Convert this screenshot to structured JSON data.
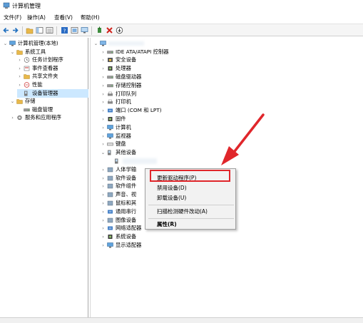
{
  "window": {
    "title": "计算机管理"
  },
  "menu": [
    "文件(F)",
    "操作(A)",
    "查看(V)",
    "帮助(H)"
  ],
  "left_tree": [
    {
      "label": "计算机管理(本地)",
      "indent": 0,
      "exp": "⌄",
      "icon": "computer-management-icon",
      "selected": false
    },
    {
      "label": "系统工具",
      "indent": 1,
      "exp": "⌄",
      "icon": "system-tools-icon",
      "selected": false
    },
    {
      "label": "任务计划程序",
      "indent": 2,
      "exp": "›",
      "icon": "task-scheduler-icon",
      "selected": false
    },
    {
      "label": "事件查看器",
      "indent": 2,
      "exp": "›",
      "icon": "event-viewer-icon",
      "selected": false
    },
    {
      "label": "共享文件夹",
      "indent": 2,
      "exp": "›",
      "icon": "shared-folders-icon",
      "selected": false
    },
    {
      "label": "性能",
      "indent": 2,
      "exp": "›",
      "icon": "performance-icon",
      "selected": false
    },
    {
      "label": "设备管理器",
      "indent": 2,
      "exp": "",
      "icon": "device-manager-icon",
      "selected": true
    },
    {
      "label": "存储",
      "indent": 1,
      "exp": "⌄",
      "icon": "storage-icon",
      "selected": false
    },
    {
      "label": "磁盘管理",
      "indent": 2,
      "exp": "",
      "icon": "disk-management-icon",
      "selected": false
    },
    {
      "label": "服务和应用程序",
      "indent": 1,
      "exp": "›",
      "icon": "services-apps-icon",
      "selected": false
    }
  ],
  "device_tree": [
    {
      "label": "IDE ATA/ATAPI 控制器",
      "indent": 1,
      "exp": "›",
      "icon": "ide-controller-icon"
    },
    {
      "label": "安全设备",
      "indent": 1,
      "exp": "›",
      "icon": "security-device-icon"
    },
    {
      "label": "处理器",
      "indent": 1,
      "exp": "›",
      "icon": "processor-icon"
    },
    {
      "label": "磁盘驱动器",
      "indent": 1,
      "exp": "›",
      "icon": "disk-drive-icon"
    },
    {
      "label": "存储控制器",
      "indent": 1,
      "exp": "›",
      "icon": "storage-controller-icon"
    },
    {
      "label": "打印队列",
      "indent": 1,
      "exp": "›",
      "icon": "print-queue-icon"
    },
    {
      "label": "打印机",
      "indent": 1,
      "exp": "›",
      "icon": "printer-icon"
    },
    {
      "label": "端口 (COM 和 LPT)",
      "indent": 1,
      "exp": "›",
      "icon": "port-icon"
    },
    {
      "label": "固件",
      "indent": 1,
      "exp": "›",
      "icon": "firmware-icon"
    },
    {
      "label": "计算机",
      "indent": 1,
      "exp": "›",
      "icon": "computer-icon"
    },
    {
      "label": "监视器",
      "indent": 1,
      "exp": "›",
      "icon": "monitor-icon"
    },
    {
      "label": "键盘",
      "indent": 1,
      "exp": "›",
      "icon": "keyboard-icon"
    },
    {
      "label": "其他设备",
      "indent": 1,
      "exp": "⌄",
      "icon": "other-devices-icon"
    },
    {
      "label": "",
      "indent": 2,
      "exp": "",
      "icon": "unknown-device-icon"
    },
    {
      "label": "人体学输",
      "indent": 1,
      "exp": "›",
      "icon": "hid-icon"
    },
    {
      "label": "软件设备",
      "indent": 1,
      "exp": "›",
      "icon": "software-device-icon"
    },
    {
      "label": "软件组件",
      "indent": 1,
      "exp": "›",
      "icon": "software-component-icon"
    },
    {
      "label": "声音、视",
      "indent": 1,
      "exp": "›",
      "icon": "audio-icon"
    },
    {
      "label": "鼠标和其",
      "indent": 1,
      "exp": "›",
      "icon": "mouse-icon"
    },
    {
      "label": "通用串行",
      "indent": 1,
      "exp": "›",
      "icon": "usb-icon"
    },
    {
      "label": "图像设备",
      "indent": 1,
      "exp": "›",
      "icon": "imaging-device-icon"
    },
    {
      "label": "网络适配器",
      "indent": 1,
      "exp": "›",
      "icon": "network-adapter-icon"
    },
    {
      "label": "系统设备",
      "indent": 1,
      "exp": "›",
      "icon": "system-device-icon"
    },
    {
      "label": "显示适配器",
      "indent": 1,
      "exp": "›",
      "icon": "display-adapter-icon"
    }
  ],
  "context_menu": {
    "update_driver": "更新驱动程序(P)",
    "disable_device": "禁用设备(D)",
    "uninstall_device": "卸载设备(U)",
    "scan_hardware": "扫描检测硬件改动(A)",
    "properties": "属性(R)"
  },
  "colors": {
    "highlight": "#e0262b",
    "arrow": "#e0262b",
    "selected_row": "#cce8ff"
  }
}
